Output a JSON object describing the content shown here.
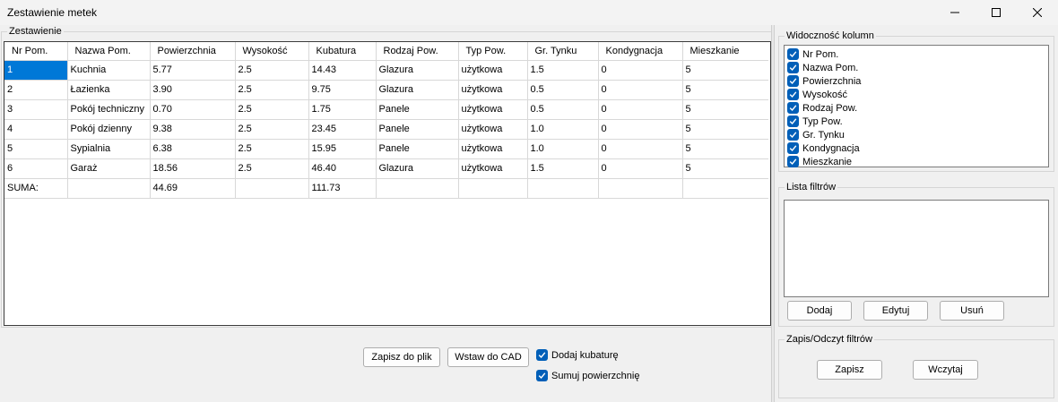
{
  "window": {
    "title": "Zestawienie metek"
  },
  "summary_group": {
    "title": "Zestawienie"
  },
  "table": {
    "columns": [
      "Nr Pom.",
      "Nazwa Pom.",
      "Powierzchnia",
      "Wysokość",
      "Kubatura",
      "Rodzaj Pow.",
      "Typ Pow.",
      "Gr. Tynku",
      "Kondygnacja",
      "Mieszkanie"
    ],
    "rows": [
      [
        "1",
        "Kuchnia",
        "5.77",
        "2.5",
        "14.43",
        "Glazura",
        "użytkowa",
        "1.5",
        "0",
        "5"
      ],
      [
        "2",
        "Łazienka",
        "3.90",
        "2.5",
        "9.75",
        "Glazura",
        "użytkowa",
        "0.5",
        "0",
        "5"
      ],
      [
        "3",
        "Pokój techniczny",
        "0.70",
        "2.5",
        "1.75",
        "Panele",
        "użytkowa",
        "0.5",
        "0",
        "5"
      ],
      [
        "4",
        "Pokój dzienny",
        "9.38",
        "2.5",
        "23.45",
        "Panele",
        "użytkowa",
        "1.0",
        "0",
        "5"
      ],
      [
        "5",
        "Sypialnia",
        "6.38",
        "2.5",
        "15.95",
        "Panele",
        "użytkowa",
        "1.0",
        "0",
        "5"
      ],
      [
        "6",
        "Garaż",
        "18.56",
        "2.5",
        "46.40",
        "Glazura",
        "użytkowa",
        "1.5",
        "0",
        "5"
      ],
      [
        "SUMA:",
        "",
        "44.69",
        "",
        "111.73",
        "",
        "",
        "",
        "",
        ""
      ]
    ]
  },
  "actions": {
    "save_file": "Zapisz do plik",
    "insert_cad": "Wstaw do CAD",
    "add_volume": "Dodaj kubaturę",
    "sum_area": "Sumuj powierzchnię"
  },
  "column_visibility": {
    "title": "Widoczność kolumn",
    "items": [
      "Nr Pom.",
      "Nazwa Pom.",
      "Powierzchnia",
      "Wysokość",
      "Rodzaj Pow.",
      "Typ Pow.",
      "Gr. Tynku",
      "Kondygnacja",
      "Mieszkanie"
    ]
  },
  "filters": {
    "title": "Lista filtrów",
    "add": "Dodaj",
    "edit": "Edytuj",
    "remove": "Usuń"
  },
  "filter_io": {
    "title": "Zapis/Odczyt filtrów",
    "save": "Zapisz",
    "load": "Wczytaj"
  },
  "colors": {
    "selection": "#0078d7",
    "checkbox": "#005fb8",
    "background": "#f0f0f0"
  }
}
